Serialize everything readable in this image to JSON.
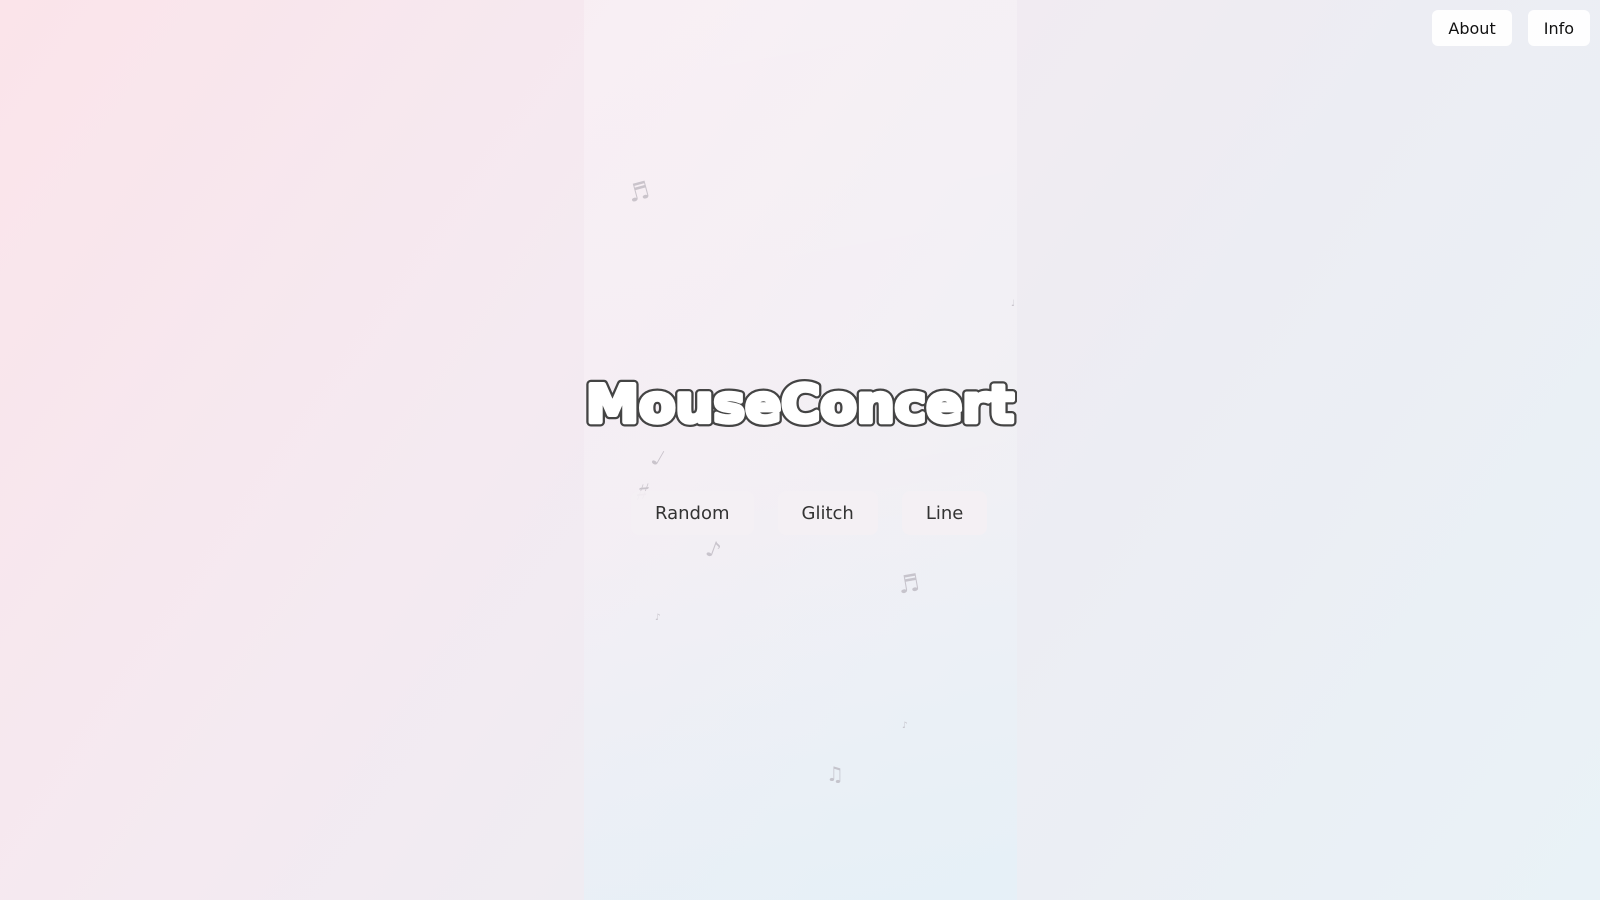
{
  "nav": {
    "about_label": "About",
    "info_label": "Info"
  },
  "logo": {
    "text": "MouseConcert"
  },
  "modes": [
    {
      "label": "Random"
    },
    {
      "label": "Glitch"
    },
    {
      "label": "Line"
    }
  ],
  "notes": [
    "♬",
    "♩",
    "♪",
    "♫",
    "♯",
    "♭"
  ],
  "colors": {
    "background_start": "#fbe4ea",
    "background_end": "#e9f2f7",
    "button_bg": "#ffffff",
    "mode_button_bg": "#f4f0f4",
    "text": "#333333",
    "note": "#a7a1ab"
  }
}
